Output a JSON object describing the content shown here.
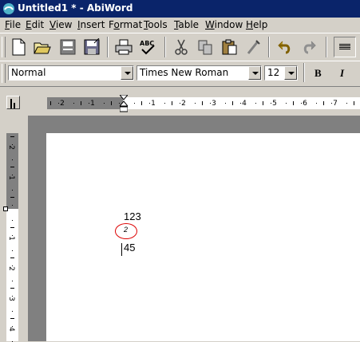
{
  "window": {
    "title": "Untitled1 * - AbiWord"
  },
  "menu": [
    {
      "label": "File",
      "ul": "F",
      "rest": "ile"
    },
    {
      "label": "Edit",
      "ul": "E",
      "rest": "dit"
    },
    {
      "label": "View",
      "ul": "V",
      "rest": "iew"
    },
    {
      "label": "Insert",
      "ul": "I",
      "rest": "nsert"
    },
    {
      "label": "Format",
      "ul": "",
      "pre": "F",
      "mid": "o",
      "post": "rmat"
    },
    {
      "label": "Tools",
      "ul": "T",
      "rest": "ools"
    },
    {
      "label": "Table",
      "ul": "T",
      "rest": "able"
    },
    {
      "label": "Window",
      "ul": "W",
      "rest": "indow"
    },
    {
      "label": "Help",
      "ul": "H",
      "rest": "elp"
    }
  ],
  "toolbar": {
    "style": "Normal",
    "font": "Times New Roman",
    "size": "12",
    "bold": "B",
    "italic": "I"
  },
  "ruler": {
    "h_labels": [
      "2",
      "1",
      "1",
      "2",
      "3",
      "4",
      "5",
      "6",
      "7"
    ],
    "v_labels": [
      "2",
      "1",
      "1",
      "2",
      "3",
      "4"
    ]
  },
  "document": {
    "line1": "123",
    "line2": "2",
    "line3": "45"
  }
}
